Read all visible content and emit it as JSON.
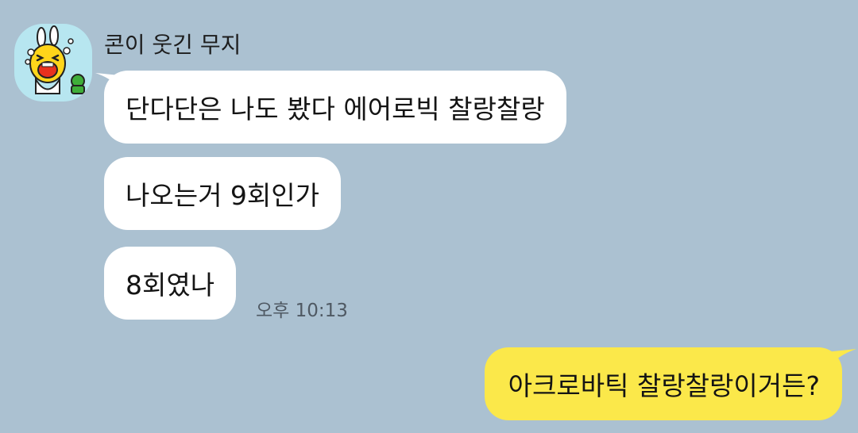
{
  "chat": {
    "sender_name": "콘이 웃긴 무지",
    "messages": [
      {
        "direction": "incoming",
        "text": "단다단은 나도 봤다 에어로빅 찰랑찰랑"
      },
      {
        "direction": "incoming",
        "text": "나오는거 9회인가"
      },
      {
        "direction": "incoming",
        "text": "8회였나",
        "time": "오후 10:13"
      },
      {
        "direction": "outgoing",
        "text": "아크로바틱 찰랑찰랑이거든?"
      }
    ]
  },
  "colors": {
    "background": "#abc1d1",
    "incoming_bubble": "#ffffff",
    "outgoing_bubble": "#fbe84a",
    "avatar_bg": "#b7e6f0"
  },
  "icons": {
    "avatar": "muzi-character-icon"
  }
}
